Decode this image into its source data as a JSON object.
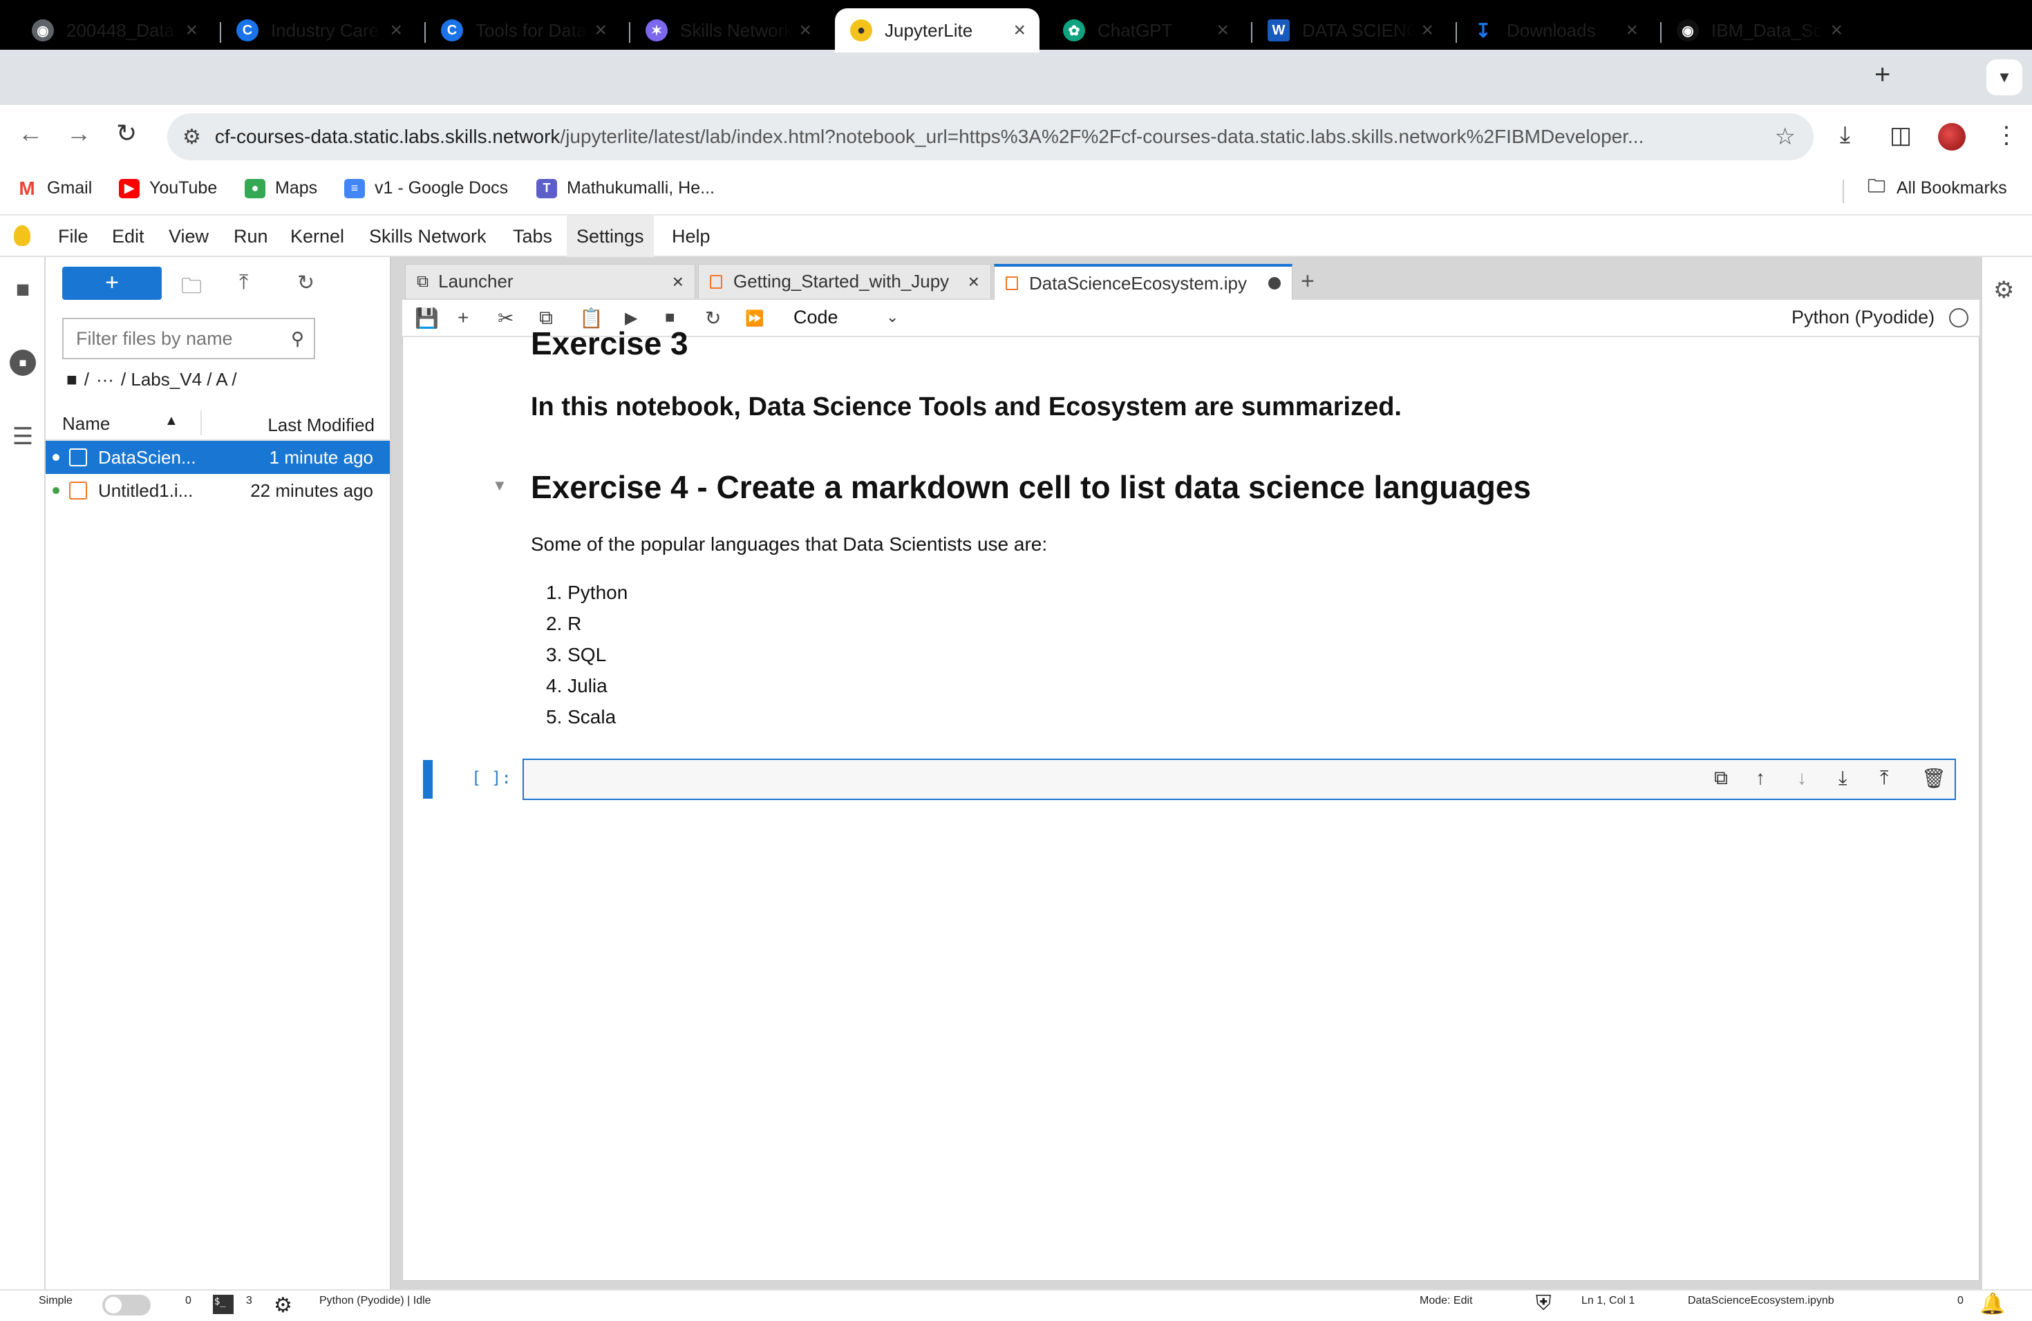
{
  "browser": {
    "tabs": [
      {
        "title": "200448_Data",
        "favicon": "globe-icon",
        "color": "#5f6368"
      },
      {
        "title": "Industry Care",
        "favicon": "c-logo-icon",
        "color": "#1a73e8"
      },
      {
        "title": "Tools for Data",
        "favicon": "c-logo-icon",
        "color": "#1a73e8"
      },
      {
        "title": "Skills Network",
        "favicon": "skills-network-icon",
        "color": "#7b68ee"
      },
      {
        "title": "JupyterLite",
        "favicon": "jupyterlite-icon",
        "color": "#f3c31b"
      },
      {
        "title": "ChatGPT",
        "favicon": "chatgpt-icon",
        "color": "#10a37f"
      },
      {
        "title": "DATA SCIENC",
        "favicon": "word-icon",
        "color": "#185abd"
      },
      {
        "title": "Downloads",
        "favicon": "download-icon",
        "color": "#1a73e8"
      },
      {
        "title": "IBM_Data_Sc",
        "favicon": "github-icon",
        "color": "#111111"
      }
    ],
    "new_tab": "+",
    "url_host": "cf-courses-data.static.labs.skills.network",
    "url_path": "/jupyterlite/latest/lab/index.html?notebook_url=https%3A%2F%2Fcf-courses-data.static.labs.skills.network%2FIBMDeveloper...",
    "bookmarks": [
      {
        "label": "Gmail",
        "icon": "gmail-icon",
        "color": "#ea4335"
      },
      {
        "label": "YouTube",
        "icon": "youtube-icon",
        "color": "#ff0000"
      },
      {
        "label": "Maps",
        "icon": "maps-icon",
        "color": "#34a853"
      },
      {
        "label": "v1 - Google Docs",
        "icon": "docs-icon",
        "color": "#4285f4"
      },
      {
        "label": "Mathukumalli, He...",
        "icon": "teams-icon",
        "color": "#5b5fc7"
      }
    ],
    "all_bookmarks": "All Bookmarks"
  },
  "jupyter": {
    "menu": [
      "File",
      "Edit",
      "View",
      "Run",
      "Kernel",
      "Skills Network",
      "Tabs",
      "Settings",
      "Help"
    ],
    "filebrowser": {
      "new_button": "+",
      "filter_placeholder": "Filter files by name",
      "breadcrumb": [
        "/",
        "···",
        "/ Labs_V4 / A /"
      ],
      "col_name": "Name",
      "col_modified": "Last Modified",
      "files": [
        {
          "name": "DataScien...",
          "modified": "1 minute ago",
          "selected": true
        },
        {
          "name": "Untitled1.i...",
          "modified": "22 minutes ago",
          "selected": false
        }
      ]
    },
    "dock_tabs": [
      {
        "label": "Launcher"
      },
      {
        "label": "Getting_Started_with_Jupy"
      },
      {
        "label": "DataScienceEcosystem.ipy"
      }
    ],
    "toolbar": {
      "cell_type": "Code",
      "kernel": "Python (Pyodide)"
    },
    "notebook": {
      "heading_ex3": "Exercise 3",
      "summary": "In this notebook, Data Science Tools and Ecosystem are summarized.",
      "heading_ex4": "Exercise 4 - Create a markdown cell to list data science languages",
      "intro": "Some of the popular languages that Data Scientists use are:",
      "languages": [
        "1. Python",
        "2. R",
        "3. SQL",
        "4. Julia",
        "5. Scala"
      ],
      "prompt": "[ ]:"
    },
    "status": {
      "mode_label": "Simple",
      "count_a": "0",
      "count_b": "3",
      "kernel_status": "Python (Pyodide) | Idle",
      "mode": "Mode: Edit",
      "cursor": "Ln 1, Col 1",
      "filename": "DataScienceEcosystem.ipynb",
      "notifications": "0"
    }
  }
}
